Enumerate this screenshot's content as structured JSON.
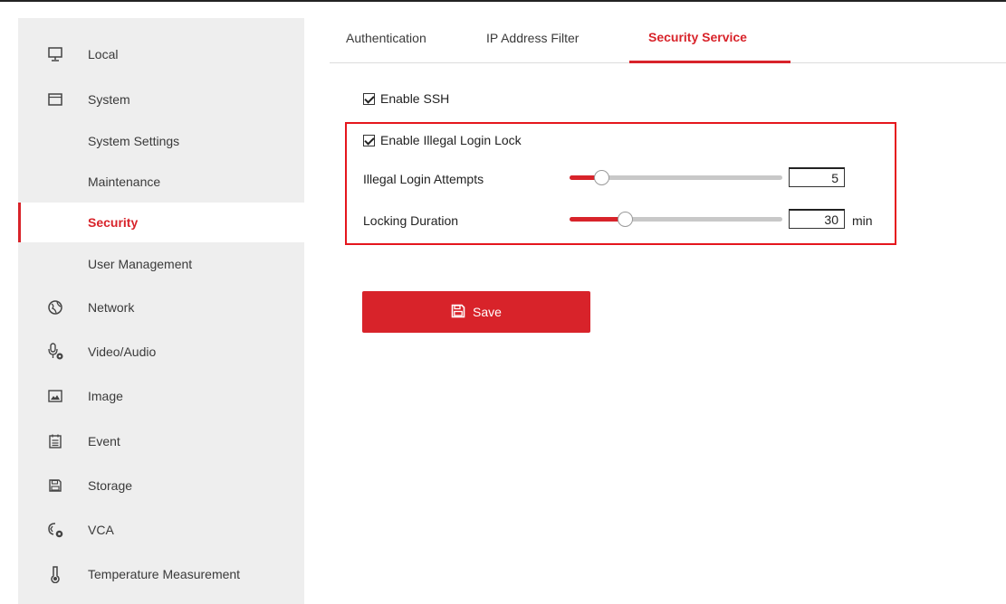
{
  "sidebar": {
    "items": [
      {
        "label": "Local",
        "icon": "monitor-icon"
      },
      {
        "label": "System",
        "icon": "window-icon"
      },
      {
        "label": "System Settings"
      },
      {
        "label": "Maintenance"
      },
      {
        "label": "Security",
        "active": true
      },
      {
        "label": "User Management"
      },
      {
        "label": "Network",
        "icon": "globe-icon"
      },
      {
        "label": "Video/Audio",
        "icon": "microphone-icon"
      },
      {
        "label": "Image",
        "icon": "image-icon"
      },
      {
        "label": "Event",
        "icon": "calendar-icon"
      },
      {
        "label": "Storage",
        "icon": "floppy-disk-icon"
      },
      {
        "label": "VCA",
        "icon": "vca-icon"
      },
      {
        "label": "Temperature Measurement",
        "icon": "thermometer-icon"
      }
    ]
  },
  "tabs": [
    {
      "label": "Authentication"
    },
    {
      "label": "IP Address Filter"
    },
    {
      "label": "Security Service",
      "active": true
    }
  ],
  "form": {
    "enable_ssh": {
      "label": "Enable SSH",
      "checked": true
    },
    "enable_illegal_login_lock": {
      "label": "Enable Illegal Login Lock",
      "checked": true
    },
    "illegal_login_attempts": {
      "label": "Illegal Login Attempts",
      "value": "5",
      "slider_fraction": 0.15
    },
    "locking_duration": {
      "label": "Locking Duration",
      "value": "30",
      "unit": "min",
      "slider_fraction": 0.26
    },
    "save_label": "Save"
  },
  "colors": {
    "accent": "#d8232a",
    "highlight_border": "#e5161d",
    "sidebar_bg": "#eeeeee"
  }
}
